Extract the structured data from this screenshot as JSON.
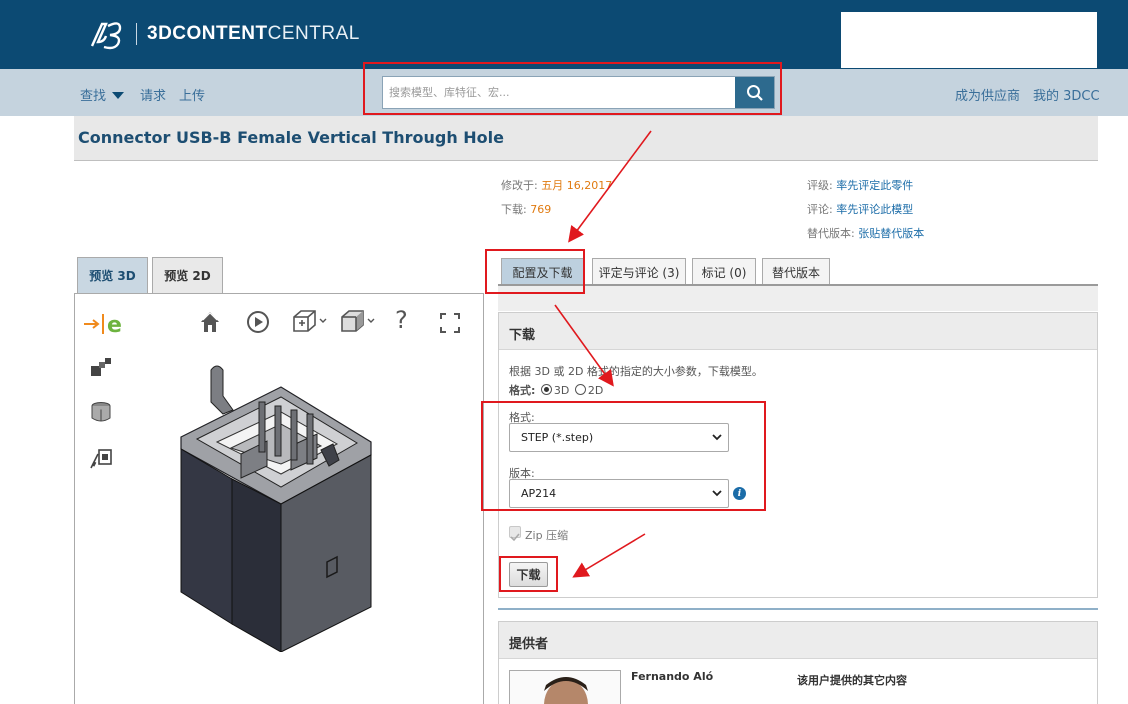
{
  "header": {
    "brand_bold": "3D",
    "brand_mid": "CONTENT",
    "brand_light": "CENTRAL"
  },
  "nav": {
    "find": "查找",
    "request": "请求",
    "upload": "上传",
    "become_supplier": "成为供应商",
    "my_3dcc": "我的 3DCC"
  },
  "search": {
    "placeholder": "搜索模型、库特征、宏..."
  },
  "part": {
    "title": "Connector USB-B Female Vertical Through Hole"
  },
  "meta": {
    "modified_label": "修改于:",
    "modified_value": "五月 16,2017",
    "downloads_label": "下载:",
    "downloads_value": "769",
    "rating_label": "评级:",
    "rating_link": "率先评定此零件",
    "comments_label": "评论:",
    "comments_link": "率先评论此模型",
    "alt_label": "替代版本:",
    "alt_link": "张贴替代版本"
  },
  "preview_tabs": [
    "预览 3D",
    "预览 2D"
  ],
  "viewer": {
    "help_glyph": "?"
  },
  "content_tabs": [
    "配置及下载",
    "评定与评论 (3)",
    "标记 (0)",
    "替代版本"
  ],
  "download_panel": {
    "title": "下载",
    "description": "根据 3D 或 2D 格式的指定的大小参数，下载模型。",
    "format_type_label": "格式:",
    "option_3d": "3D",
    "option_2d": "2D",
    "format_label": "格式:",
    "format_value": "STEP (*.step)",
    "version_label": "版本:",
    "version_value": "AP214",
    "zip_label": "Zip 压缩",
    "download_button": "下载"
  },
  "provider_panel": {
    "title": "提供者",
    "name": "Fernando Aló",
    "other_content": "该用户提供的其它内容"
  },
  "colors": {
    "header_bg": "#0c4a73",
    "nav_bg": "#c5d3de",
    "link": "#1b6ca8",
    "accent_orange": "#e07a10",
    "annotation_red": "#e0191e"
  }
}
